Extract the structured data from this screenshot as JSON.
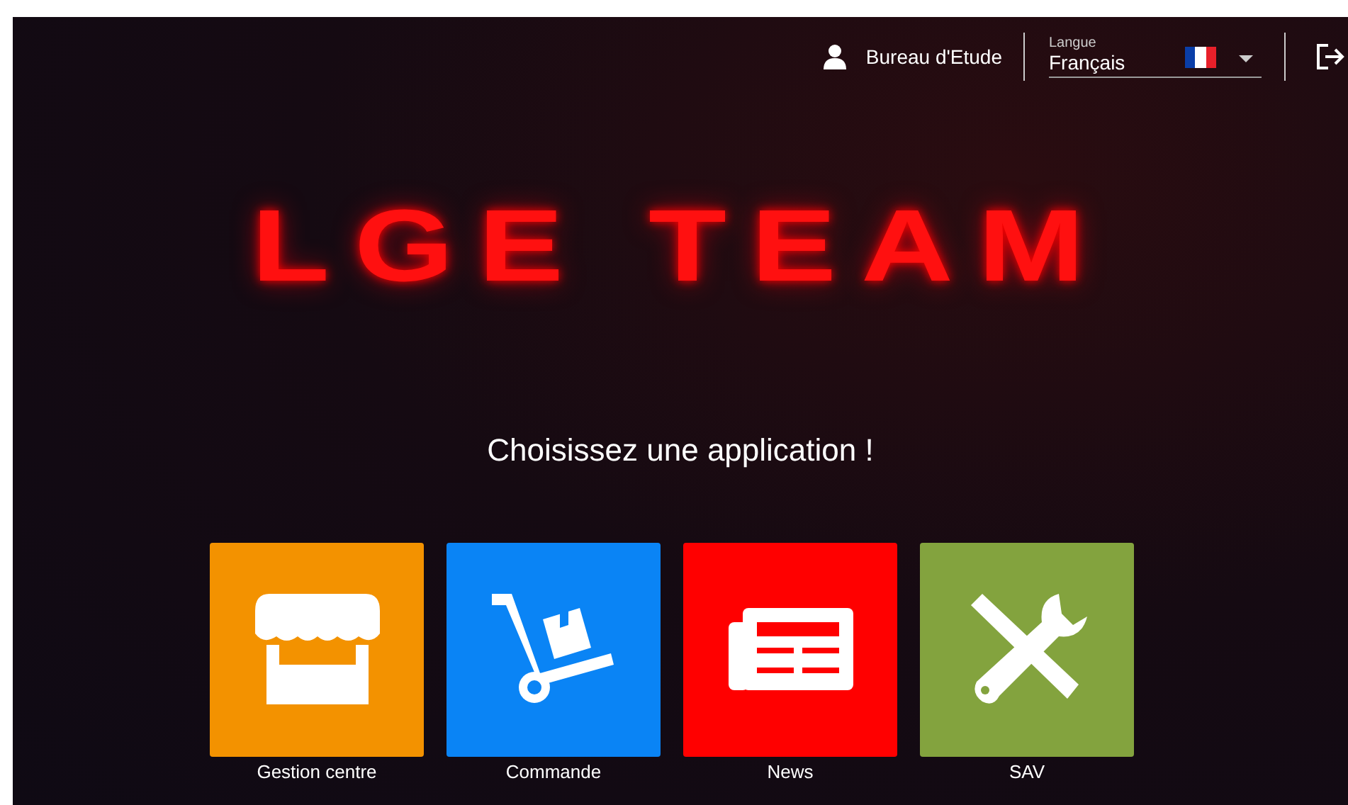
{
  "header": {
    "user": "Bureau d'Etude",
    "language": {
      "label": "Langue",
      "value": "Français"
    }
  },
  "logo": "LGE TEAM",
  "prompt": "Choisissez une application !",
  "apps": [
    {
      "label": "Gestion centre",
      "color": "#f39200",
      "kind": "store"
    },
    {
      "label": "Commande",
      "color": "#0a84f5",
      "kind": "cart"
    },
    {
      "label": "News",
      "color": "#ff0000",
      "kind": "news"
    },
    {
      "label": "SAV",
      "color": "#83a33e",
      "kind": "tools"
    }
  ]
}
